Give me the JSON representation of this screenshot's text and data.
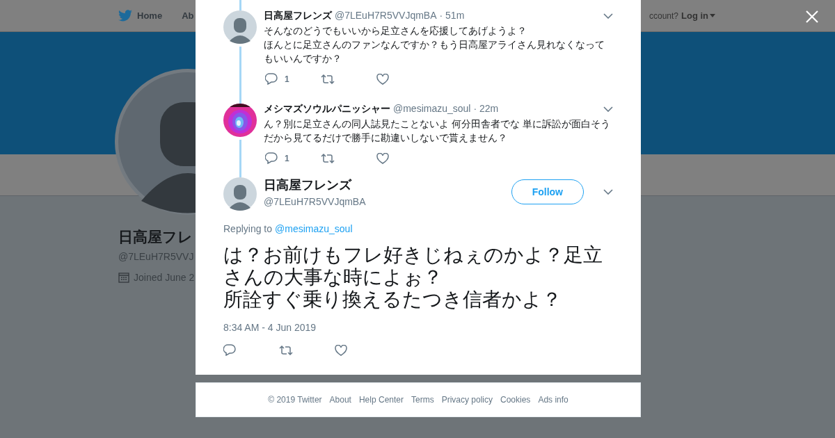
{
  "nav": {
    "home": "Home",
    "about": "Ab",
    "account": "ccount?",
    "login": "Log in"
  },
  "profile": {
    "name": "日高屋フレ",
    "handle": "@7LEuH7R5VVJ",
    "joined": "Joined June 2"
  },
  "thread": [
    {
      "name": "日高屋フレンズ",
      "handle": "@7LEuH7R5VVJqmBA",
      "time": "· 51m",
      "kind": "default",
      "lines": [
        "そんなのどうでもいいから足立さんを応援してあげようよ？",
        "ほんとに足立さんのファンなんですか？もう日高屋アライさん見れなくなってもいいんですか？"
      ],
      "replies": "1"
    },
    {
      "name": "メシマズソウルパニッシャー",
      "handle": "@mesimazu_soul",
      "time": "· 22m",
      "kind": "picture",
      "lines": [
        "ん？別に足立さんの同人誌見たことないよ 何分田舎者でな 単に訴訟が面白そうだから見てるだけで勝手に勘違いしないで貰えません？"
      ],
      "replies": "1"
    }
  ],
  "tweet": {
    "name": "日高屋フレンズ",
    "handle": "@7LEuH7R5VVJqmBA",
    "follow": "Follow",
    "replying_to": "Replying to",
    "reply_handle": "@mesimazu_soul",
    "lines": [
      "は？お前けもフレ好きじねぇのかよ？足立さんの大事な時によぉ？",
      "所詮すぐ乗り換えるたつき信者かよ？"
    ],
    "timestamp": "8:34 AM - 4 Jun 2019"
  },
  "footer": [
    "© 2019 Twitter",
    "About",
    "Help Center",
    "Terms",
    "Privacy policy",
    "Cookies",
    "Ads info"
  ]
}
